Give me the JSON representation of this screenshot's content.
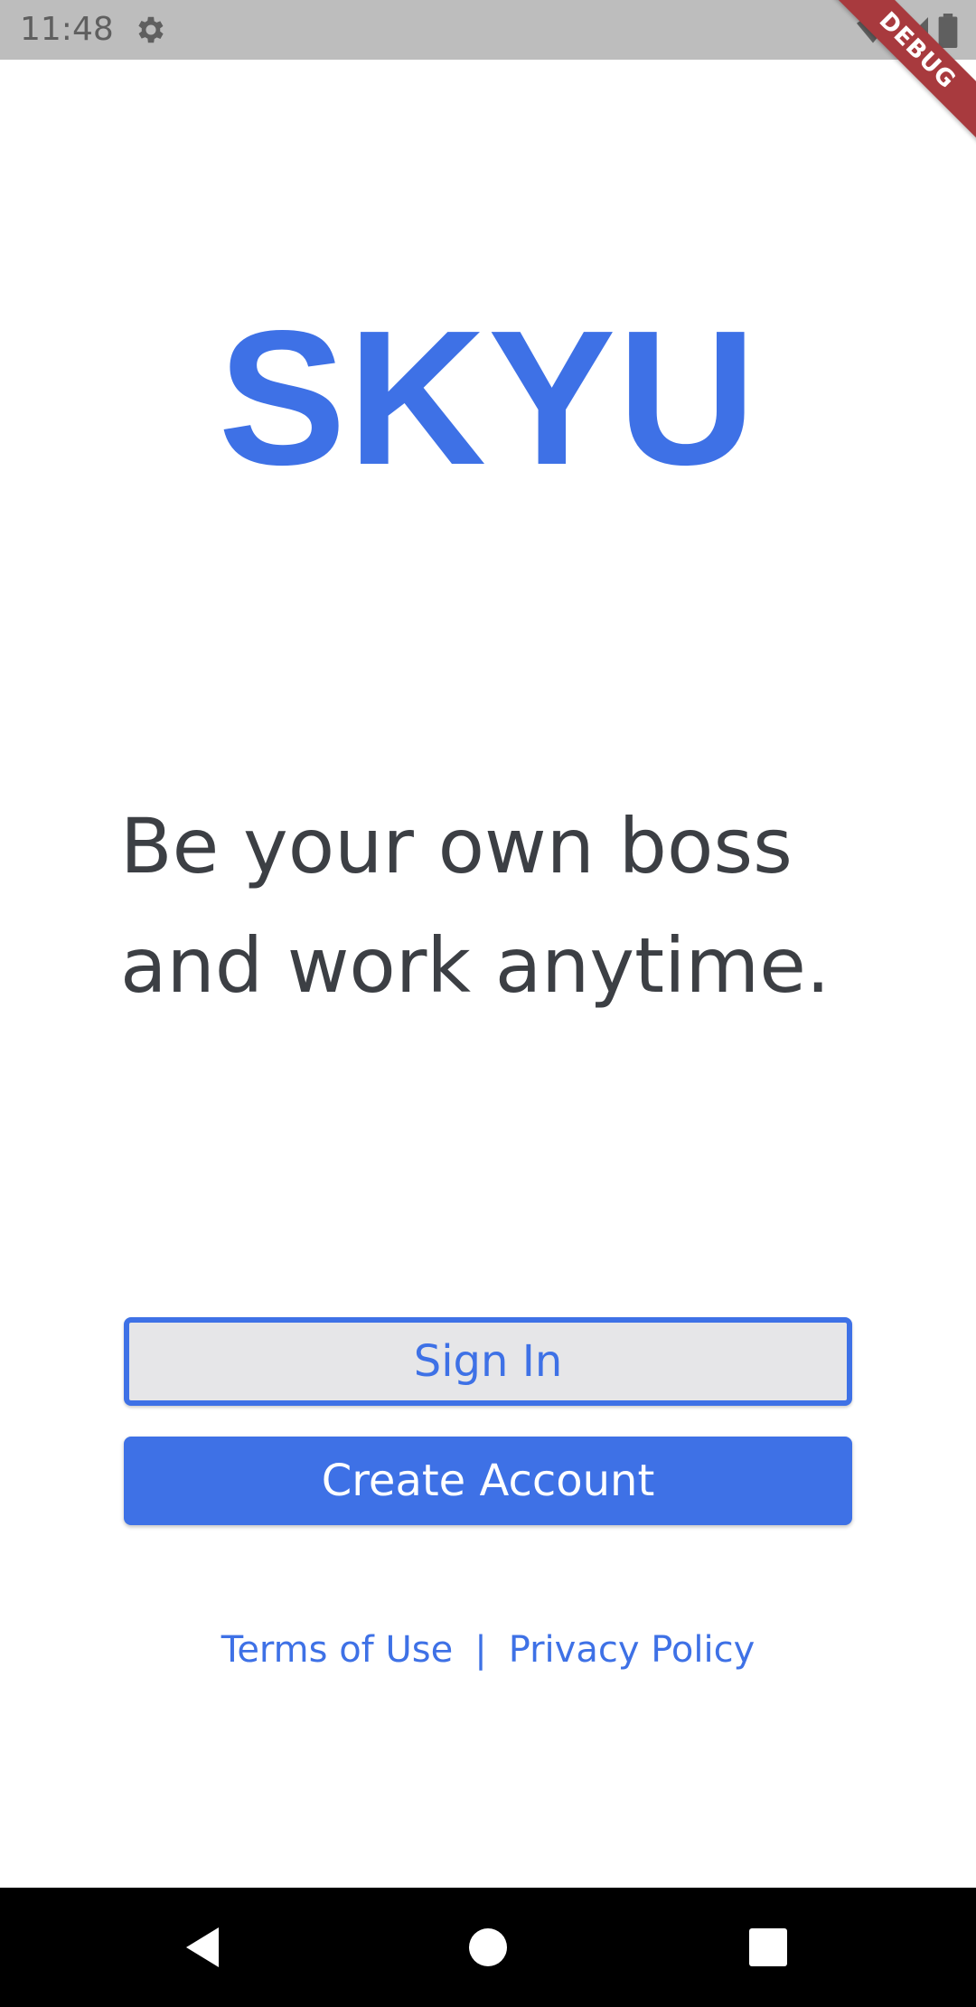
{
  "status_bar": {
    "time": "11:48",
    "icons": [
      "settings-gear-icon",
      "wifi-icon",
      "signal-icon",
      "battery-icon"
    ]
  },
  "debug_banner": {
    "label": "DEBUG"
  },
  "logo": {
    "text": "SKYU"
  },
  "tagline": {
    "line1": "Be your own boss",
    "line2": "and work anytime."
  },
  "buttons": {
    "sign_in": "Sign In",
    "create_account": "Create Account"
  },
  "links": {
    "terms": "Terms of Use",
    "separator": "|",
    "privacy": "Privacy Policy"
  },
  "nav_bar": {
    "icons": [
      "back-icon",
      "home-icon",
      "recents-icon"
    ]
  },
  "colors": {
    "accent": "#3e71e6",
    "text_dark": "#3c3f44",
    "status_bar": "#bdbdbd",
    "debug_ribbon": "#a83a3e",
    "nav_bar": "#000000"
  }
}
